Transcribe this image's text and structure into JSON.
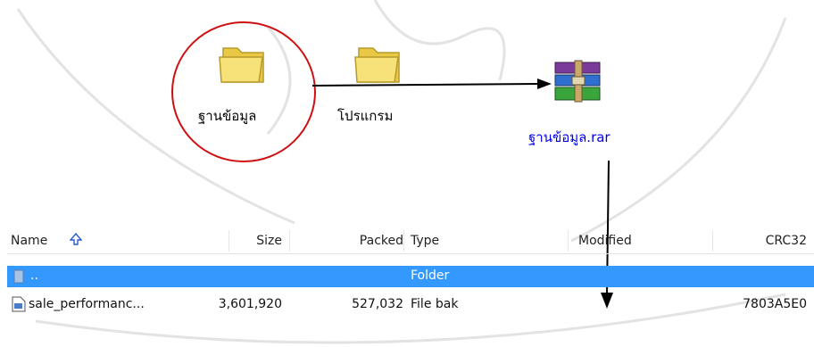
{
  "folders": [
    {
      "label": "ฐานข้อมูล"
    },
    {
      "label": "โปรแกรม"
    }
  ],
  "archive": {
    "label": "ฐานข้อมูล.rar",
    "icon": "winrar-archive-icon"
  },
  "colors": {
    "highlight_circle": "#d01010",
    "selection": "#3399ff",
    "link": "#0000ee"
  },
  "table": {
    "sort_icon": "arrow-up-icon",
    "columns": [
      "Name",
      "Size",
      "Packed",
      "Type",
      "Modified",
      "CRC32"
    ],
    "rows": [
      {
        "name": "..",
        "size": "",
        "packed": "",
        "type": "Folder",
        "modified": "",
        "crc": "",
        "selected": true
      },
      {
        "name": "sale_performanc...",
        "size": "3,601,920",
        "packed": "527,032",
        "type": "File bak",
        "modified": "",
        "crc": "7803A5E0",
        "selected": false
      }
    ]
  }
}
